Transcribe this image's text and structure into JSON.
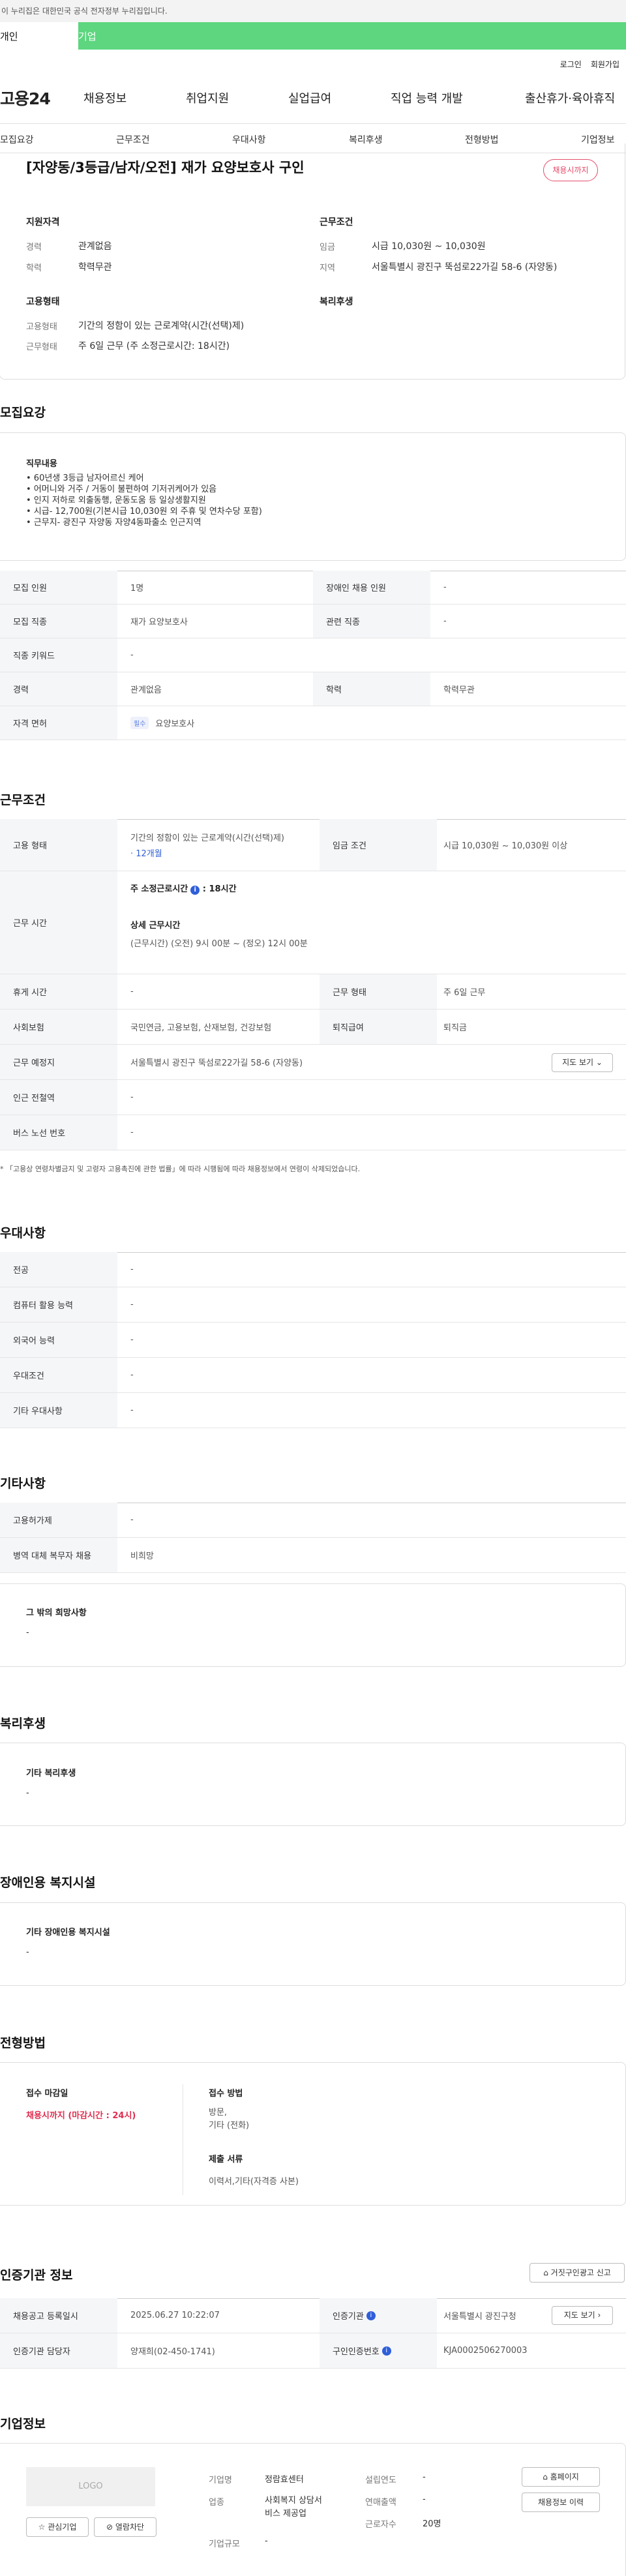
{
  "gov_notice": "이 누리집은 대한민국 공식 전자정부 누리집입니다.",
  "top_tabs": [
    "개인",
    "기업"
  ],
  "util": [
    "로그인",
    "회원가입"
  ],
  "logo": "고용24",
  "gnb": [
    "채용정보",
    "취업지원",
    "실업급여",
    "직업 능력 개발",
    "출산휴가·육아휴직"
  ],
  "lnb": [
    "모집요강",
    "근무조건",
    "우대사항",
    "복리후생",
    "전형방법",
    "기업정보"
  ],
  "job": {
    "title": "[자양동/3등급/남자/오전] 재가 요양보호사 구인",
    "status": "채용시까지",
    "qual_head": "지원자격",
    "career_label": "경력",
    "career": "관계없음",
    "edu_label": "학력",
    "edu": "학력무관",
    "work_head": "근무조건",
    "wage_label": "임금",
    "wage": "시급 10,030원 ~ 10,030원",
    "area_label": "지역",
    "area": "서울특별시 광진구 뚝섬로22가길 58-6 (자양동)",
    "emp_head": "고용형태",
    "emptype_label": "고용형태",
    "emptype": "기간의 정함이 있는 근로계약(시간(선택)제)",
    "worktype_label": "근무형태",
    "worktype": "주 6일 근무 (주 소정근로시간: 18시간)",
    "welfare_head": "복리후생"
  },
  "recruit": {
    "title": "모집요강",
    "duty_head": "직무내용",
    "duty_lines": [
      "• 60년생 3등급 남자어르신 케어",
      "• 어머니와 거주 / 거동이 불편하여 기저귀케어가 있음",
      "• 인지 저하로 외출동행, 운동도움 등 일상생활지원",
      "• 시급- 12,700원(기본시급 10,030원 외 주휴 및 연차수당 포함)",
      "• 근무지- 광진구 자양동 자양4동파출소 인근지역"
    ],
    "rows": [
      {
        "th1": "모집 인원",
        "td1": "1명",
        "th2": "장애인 채용 인원",
        "td2": "-"
      },
      {
        "th1": "모집 직종",
        "td1": "재가 요양보호사",
        "th2": "관련 직종",
        "td2": "-"
      },
      {
        "th1": "직종 키워드",
        "td1": "-"
      },
      {
        "th1": "경력",
        "td1": "관계없음",
        "th2": "학력",
        "td2": "학력무관"
      },
      {
        "th1": "자격 면허",
        "chip": "필수",
        "td1": "요양보호사"
      }
    ]
  },
  "conditions": {
    "title": "근무조건",
    "emp_th": "고용 형태",
    "emp_td": "기간의 정함이 있는 근로계약(시간(선택)제)",
    "emp_period": "· 12개월",
    "wage_th": "임금 조건",
    "wage_td": "시급 10,030원 ~ 10,030원 이상",
    "time_th": "근무 시간",
    "time_week": "주 소정근로시간",
    "time_week_val": "18시간",
    "time_detail_head": "상세 근무시간",
    "time_detail": "(근무시간) (오전) 9시 00분 ~ (정오) 12시 00분",
    "rest_th": "휴게 시간",
    "rest_td": "-",
    "form_th": "근무 형태",
    "form_td": "주 6일 근무",
    "ins_th": "사회보험",
    "ins_td": "국민연금, 고용보험, 산재보험, 건강보험",
    "ret_th": "퇴직급여",
    "ret_td": "퇴직금",
    "place_th": "근무 예정지",
    "place_td": "서울특별시 광진구 뚝섬로22가길 58-6 (자양동)",
    "map_btn": "지도 보기",
    "subway_th": "인근 전철역",
    "subway_td": "-",
    "bus_th": "버스 노선 번호",
    "bus_td": "-",
    "note": "* 「고용상 연령차별금지 및 고령자 고용촉진에 관한 법률」에 따라 시행됨에 따라 채용정보에서 연령이 삭제되었습니다."
  },
  "prefer": {
    "title": "우대사항",
    "rows": [
      {
        "th": "전공",
        "td": "-"
      },
      {
        "th": "컴퓨터 활용 능력",
        "td": "-"
      },
      {
        "th": "외국어 능력",
        "td": "-"
      },
      {
        "th": "우대조건",
        "td": "-"
      },
      {
        "th": "기타 우대사항",
        "td": "-"
      }
    ]
  },
  "etc": {
    "title": "기타사항",
    "rows": [
      {
        "th": "고용허가제",
        "td": "-"
      },
      {
        "th": "병역 대체 복무자 채용",
        "td": "비희망"
      }
    ],
    "wish_head": "그 밖의 희망사항",
    "wish": "-"
  },
  "welfare": {
    "title": "복리후생",
    "head": "기타 복리후생",
    "val": "-"
  },
  "disabled": {
    "title": "장애인용 복지시설",
    "head": "기타 장애인용 복지시설",
    "val": "-"
  },
  "selection": {
    "title": "전형방법",
    "deadline_head": "접수 마감일",
    "deadline": "채용시까지 (마감시간 : 24시)",
    "method_head": "접수 방법",
    "method": [
      "방문,",
      "기타 (전화)"
    ],
    "docs_head": "제출 서류",
    "docs": "이력서,기타(자격증 사본)"
  },
  "cert": {
    "title": "인증기관 정보",
    "report_btn": "거짓구인광고 신고",
    "reg_th": "채용공고 등록일시",
    "reg_td": "2025.06.27 10:22:07",
    "org_th": "인증기관",
    "org_td": "서울특별시 광진구청",
    "map_btn": "지도 보기",
    "mgr_th": "인증기관 담당자",
    "mgr_td": "양재희(02-450-1741)",
    "no_th": "구인인증번호",
    "no_td": "KJA0002506270003"
  },
  "company": {
    "title": "기업정보",
    "logo": "LOGO",
    "fav_btn": "관심기업",
    "block_btn": "열람차단",
    "name_label": "기업명",
    "name": "정람효센터",
    "type_label": "업종",
    "type": [
      "사회복지 상담서",
      "비스 제공업"
    ],
    "size_label": "기업규모",
    "size": "-",
    "est_label": "설립연도",
    "est": "-",
    "sales_label": "연매출액",
    "sales": "-",
    "emp_label": "근로자수",
    "emp": "20명",
    "home_btn": "홈페이지",
    "hist_btn": "채용정보 이력"
  },
  "colors": {
    "brand": "#5dd67f",
    "accent": "#e02d4f",
    "link": "#2f5fd8"
  }
}
